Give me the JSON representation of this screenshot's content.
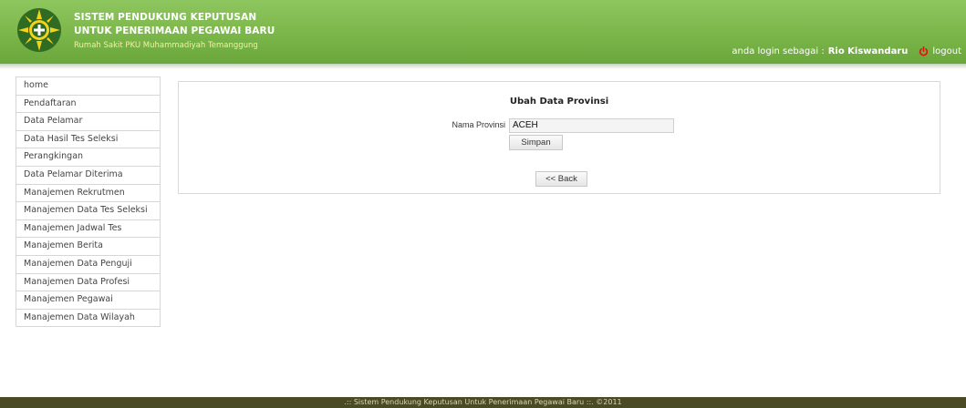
{
  "header": {
    "title_line1": "SISTEM PENDUKUNG KEPUTUSAN",
    "title_line2": "UNTUK PENERIMAAN PEGAWAI BARU",
    "subtitle": "Rumah Sakit PKU Muhammadiyah Temanggung",
    "login_prefix": "anda login sebagai :",
    "user_name": "Rio Kiswandaru",
    "logout_label": "logout",
    "logo_icon": "hospital-logo-icon",
    "logout_icon": "power-icon",
    "bar_color": "#7bb64a"
  },
  "sidebar": {
    "items": [
      {
        "label": "home"
      },
      {
        "label": "Pendaftaran"
      },
      {
        "label": "Data Pelamar"
      },
      {
        "label": "Data Hasil Tes Seleksi"
      },
      {
        "label": "Perangkingan"
      },
      {
        "label": "Data Pelamar Diterima"
      },
      {
        "label": "Manajemen Rekrutmen"
      },
      {
        "label": "Manajemen Data Tes Seleksi"
      },
      {
        "label": "Manajemen Jadwal Tes"
      },
      {
        "label": "Manajemen Berita"
      },
      {
        "label": "Manajemen Data Penguji"
      },
      {
        "label": "Manajemen Data Profesi"
      },
      {
        "label": "Manajemen Pegawai"
      },
      {
        "label": "Manajemen Data Wilayah"
      }
    ]
  },
  "main": {
    "title": "Ubah Data Provinsi",
    "field_label": "Nama Provinsi",
    "field_value": "ACEH",
    "save_label": "Simpan",
    "back_label": "<< Back"
  },
  "footer": {
    "text": ".:: Sistem Pendukung Keputusan Untuk Penerimaan Pegawai Baru ::. ©2011",
    "color": "#4a4a25"
  }
}
